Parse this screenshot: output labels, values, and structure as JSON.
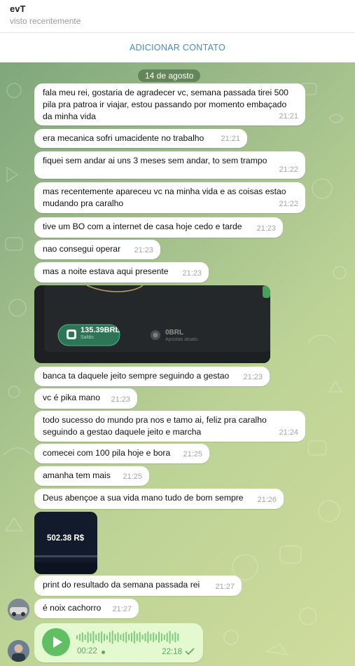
{
  "header": {
    "name": "evT",
    "status": "visto recentemente"
  },
  "add_contact": "ADICIONAR CONTATO",
  "date": "14 de agosto",
  "messages": [
    {
      "text": "fala meu rei, gostaria de agradecer vc, semana passada tirei 500\npila pra patroa ir viajar, estou passando por momento embaçado\nda minha vida",
      "time": "21:21"
    },
    {
      "text": "era mecanica sofri umacidente no trabalho",
      "time": "21:21"
    },
    {
      "text": "fiquei sem andar ai uns 3 meses sem andar, to sem trampo",
      "time": "21:22"
    },
    {
      "text": "mas recentemente apareceu vc na minha vida e as coisas estao\nmudando pra caralho",
      "time": "21:22"
    },
    {
      "text": "tive um BO com a internet de casa hoje cedo e tarde",
      "time": "21:23"
    },
    {
      "text": "nao consegui operar",
      "time": "21:23"
    },
    {
      "text": "mas a noite estava aqui presente",
      "time": "21:23"
    },
    {
      "text": "banca ta daquele jeito sempre seguindo a gestao",
      "time": "21:23"
    },
    {
      "text": "vc é pika mano",
      "time": "21:23"
    },
    {
      "text": "todo sucesso do mundo pra nos e tamo ai, feliz pra caralho\nseguindo a gestao daquele jeito e marcha",
      "time": "21:24"
    },
    {
      "text": "comecei com 100 pila hoje e bora",
      "time": "21:25"
    },
    {
      "text": "amanha tem mais",
      "time": "21:25"
    },
    {
      "text": "Deus abençoe a sua vida mano tudo de bom sempre",
      "time": "21:26"
    },
    {
      "text": "print do resultado da semana passada rei",
      "time": "21:27"
    },
    {
      "text": "é noix cachorro",
      "time": "21:27"
    }
  ],
  "screenshot1": {
    "balance": "135.39BRL",
    "balance_label": "Saldo:",
    "bets": "0BRL",
    "bets_label": "Apostas atuais:"
  },
  "screenshot2": {
    "amount": "502.38 R$"
  },
  "voice": {
    "duration": "00:22",
    "time": "22:18"
  }
}
